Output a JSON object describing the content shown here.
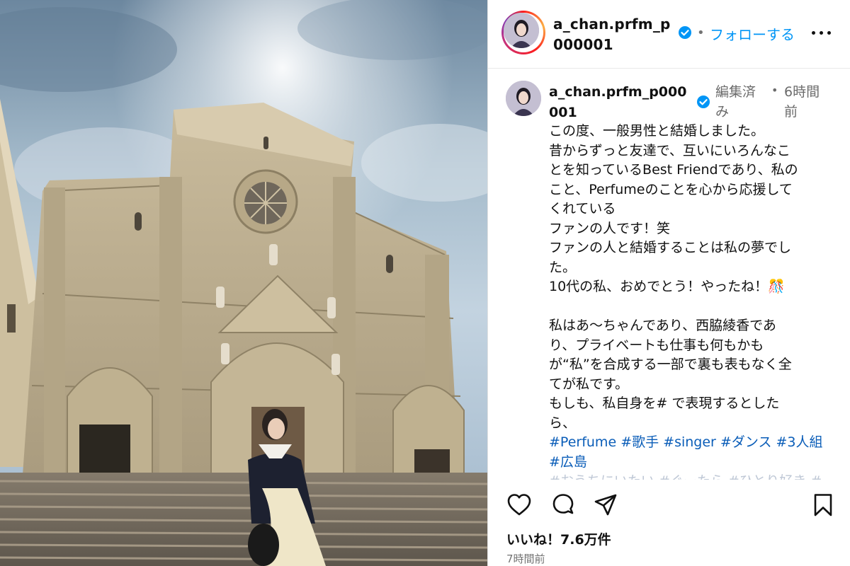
{
  "post": {
    "username": "a_chan.prfm_p000001",
    "follow_label": "フォローする",
    "caption_username": "a_chan.prfm_p000001",
    "edited_label": "編集済み",
    "caption_time": "6時間前",
    "caption_lines": [
      "この度、一般男性と結婚しました。",
      "昔からずっと友達で、互いにいろんなこ",
      "とを知っているBest Friendであり、私の",
      "こと、Perfumeのことを心から応援して",
      "くれている",
      "ファンの人です！笑",
      "ファンの人と結婚することは私の夢でし",
      "た。",
      "10代の私、おめでとう！やったね！🎊",
      "",
      "私はあ～ちゃんであり、西脇綾香であ",
      "り、プライベートも仕事も何もかも",
      "が“私”を合成する一部で裏も表もなく全",
      "てが私です。",
      "もしも、私自身を# で表現するとした",
      "ら、"
    ],
    "hashtags_line1": [
      "#Perfume",
      "#歌手",
      "#singer",
      "#ダンス",
      "#3人組"
    ],
    "hashtags_line2": [
      "#広島"
    ],
    "faded_line": "#おうちにいたい #ぐーたら #ひとり好き #...",
    "likes_label": "いいね！7.6万件",
    "posted_ago": "7時間前"
  },
  "icons": [
    "verified-badge-icon",
    "more-options-icon",
    "heart-icon",
    "comment-icon",
    "share-icon",
    "bookmark-icon"
  ],
  "colors": {
    "link": "#0095f6",
    "hashtag": "#0a5db8",
    "verified": "#0095f6",
    "muted": "#737373"
  }
}
